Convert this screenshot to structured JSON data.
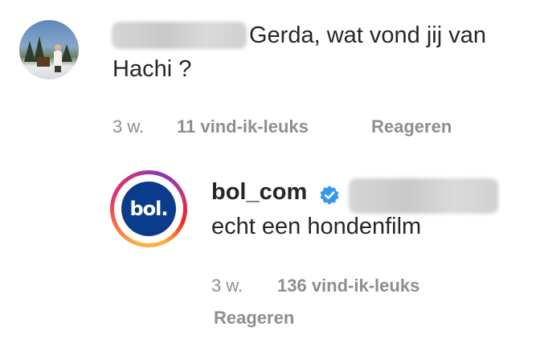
{
  "comment": {
    "text_line1": "Gerda, wat vond jij van",
    "text_line2": "Hachi ?",
    "time": "3 w.",
    "likes": "11 vind-ik-leuks",
    "reply_label": "Reageren"
  },
  "reply": {
    "avatar_text": "bol.",
    "username": "bol_com",
    "text": "echt een hondenfilm",
    "time": "3 w.",
    "likes": "136 vind-ik-leuks",
    "reply_label": "Reageren"
  },
  "colors": {
    "verified_badge": "#3897f0",
    "meta_text": "#8e8e8e",
    "brand_blue": "#0b3c8c"
  }
}
